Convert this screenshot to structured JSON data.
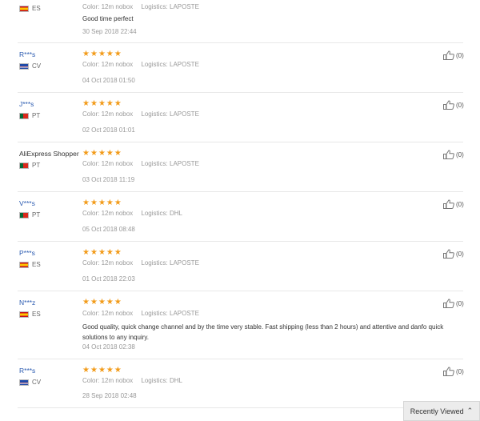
{
  "labels": {
    "color": "Color:",
    "logistics": "Logistics:"
  },
  "star_color": "#f29b1a",
  "reviews": [
    {
      "name": "",
      "country": "ES",
      "flag": "es",
      "rating": 5,
      "color": "12m nobox",
      "logistics": "LAPOSTE",
      "content": "Good time perfect",
      "date": "30 Sep 2018 22:44",
      "helpful": ""
    },
    {
      "name": "R***s",
      "country": "CV",
      "flag": "cv",
      "rating": 5,
      "color": "12m nobox",
      "logistics": "LAPOSTE",
      "content": "",
      "date": "04 Oct 2018 01:50",
      "helpful": "(0)"
    },
    {
      "name": "J***s",
      "country": "PT",
      "flag": "pt",
      "rating": 5,
      "color": "12m nobox",
      "logistics": "LAPOSTE",
      "content": "",
      "date": "02 Oct 2018 01:01",
      "helpful": "(0)"
    },
    {
      "name": "AliExpress Shopper",
      "country": "PT",
      "flag": "pt",
      "rating": 5,
      "color": "12m nobox",
      "logistics": "LAPOSTE",
      "content": "",
      "date": "03 Oct 2018 11:19",
      "helpful": "(0)"
    },
    {
      "name": "V***s",
      "country": "PT",
      "flag": "pt",
      "rating": 5,
      "color": "12m nobox",
      "logistics": "DHL",
      "content": "",
      "date": "05 Oct 2018 08:48",
      "helpful": "(0)"
    },
    {
      "name": "P***s",
      "country": "ES",
      "flag": "es",
      "rating": 5,
      "color": "12m nobox",
      "logistics": "LAPOSTE",
      "content": "",
      "date": "01 Oct 2018 22:03",
      "helpful": "(0)"
    },
    {
      "name": "N***z",
      "country": "ES",
      "flag": "es",
      "rating": 5,
      "color": "12m nobox",
      "logistics": "LAPOSTE",
      "content": "Good quality, quick change channel and by the time very stable. Fast shipping (less than 2 hours) and attentive and danfo quick solutions to any inquiry.",
      "date": "04 Oct 2018 02:38",
      "helpful": "(0)"
    },
    {
      "name": "R***s",
      "country": "CV",
      "flag": "cv",
      "rating": 5,
      "color": "12m nobox",
      "logistics": "DHL",
      "content": "",
      "date": "28 Sep 2018 02:48",
      "helpful": "(0)"
    }
  ],
  "recently_viewed": {
    "label": "Recently Viewed",
    "icon": "chevron-up-icon"
  }
}
